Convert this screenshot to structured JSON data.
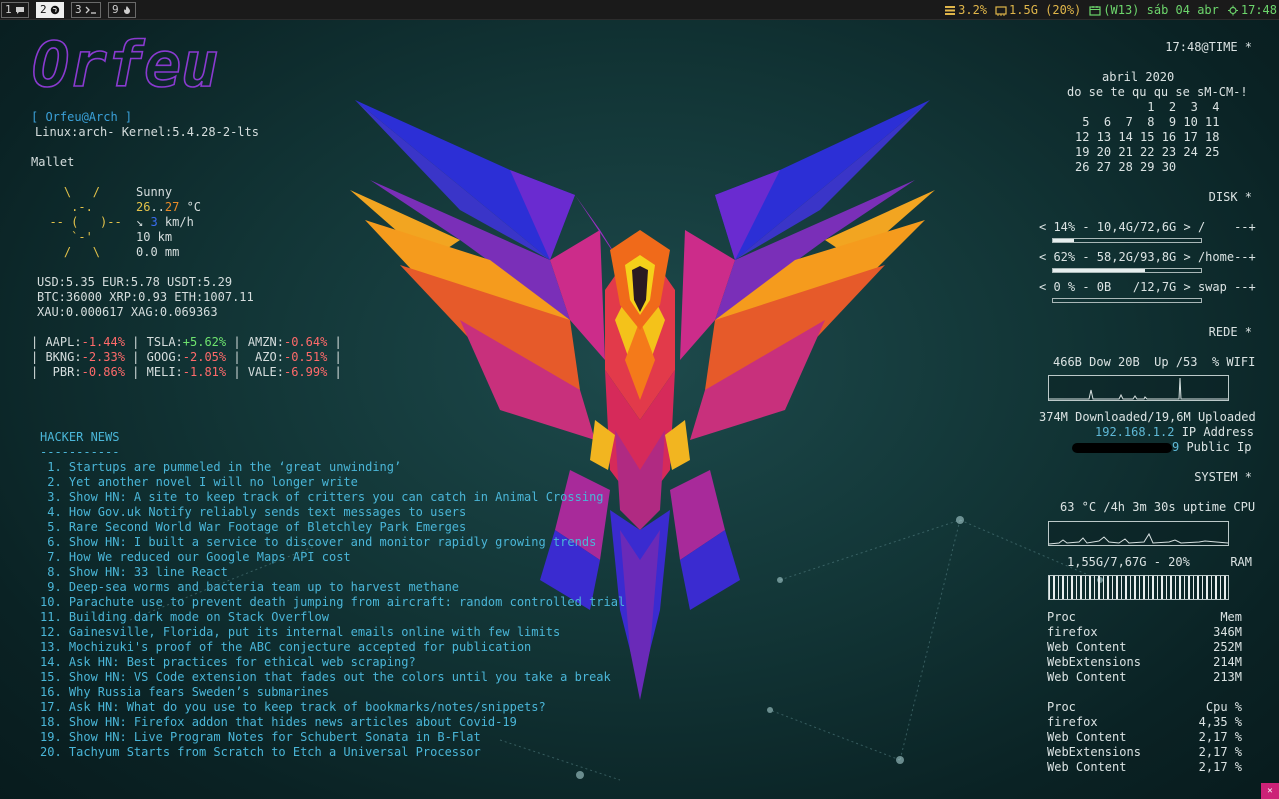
{
  "topbar": {
    "workspaces": [
      {
        "num": "1",
        "icon": "chat-icon",
        "active": false
      },
      {
        "num": "2",
        "icon": "globe-icon",
        "active": true
      },
      {
        "num": "3",
        "icon": "terminal-icon",
        "active": false
      },
      {
        "num": "9",
        "icon": "fire-icon",
        "active": false
      }
    ],
    "cpu": "3.2%",
    "memory": "1.5G (20%)",
    "date": "(W13) sáb 04 abr",
    "time": "17:48"
  },
  "left": {
    "user": "[ Orfeu@Arch ]",
    "kernel": "Linux:arch- Kernel:5.4.28-2-lts",
    "location": "Mallet",
    "weather": {
      "art": [
        "    \\   /    ",
        "     .-.     ",
        "  -- (   )-- ",
        "     `-'     ",
        "    /   \\    "
      ],
      "condition": "Sunny",
      "temp_lo": "26",
      "temp_sep": "..",
      "temp_hi": "27",
      "temp_unit": " °C",
      "wind_arrow": "↘",
      "wind_speed": "3",
      "wind_unit": " km/h",
      "visibility": "10 km",
      "rain": "0.0 mm"
    },
    "currency": [
      "USD:5.35 EUR:5.78 USDT:5.29",
      "BTC:36000 XRP:0.93 ETH:1007.11",
      "XAU:0.000617 XAG:0.069363"
    ],
    "stocks": [
      [
        {
          "sym": "AAPL",
          "val": "-1.44%",
          "pos": false
        },
        {
          "sym": "TSLA",
          "val": "+5.62%",
          "pos": true
        },
        {
          "sym": "AMZN",
          "val": "-0.64%",
          "pos": false
        }
      ],
      [
        {
          "sym": "BKNG",
          "val": "-2.33%",
          "pos": false
        },
        {
          "sym": "GOOG",
          "val": "-2.05%",
          "pos": false
        },
        {
          "sym": " AZO",
          "val": "-0.51%",
          "pos": false
        }
      ],
      [
        {
          "sym": " PBR",
          "val": "-0.86%",
          "pos": false
        },
        {
          "sym": "MELI",
          "val": "-1.81%",
          "pos": false
        },
        {
          "sym": "VALE",
          "val": "-6.99%",
          "pos": false
        }
      ]
    ],
    "hn_title": "HACKER NEWS",
    "hn_sep": "-----------",
    "hn_items": [
      " 1. Startups are pummeled in the ‘great unwinding’",
      " 2. Yet another novel I will no longer write",
      " 3. Show HN: A site to keep track of critters you can catch in Animal Crossing",
      " 4. How Gov.uk Notify reliably sends text messages to users",
      " 5. Rare Second World War Footage of Bletchley Park Emerges",
      " 6. Show HN: I built a service to discover and monitor rapidly growing trends",
      " 7. How We reduced our Google Maps API cost",
      " 8. Show HN: 33 line React",
      " 9. Deep-sea worms and bacteria team up to harvest methane",
      "10. Parachute use to prevent death jumping from aircraft: random controlled trial",
      "11. Building dark mode on Stack Overflow",
      "12. Gainesville, Florida, put its internal emails online with few limits",
      "13. Mochizuki's proof of the ABC conjecture accepted for publication",
      "14. Ask HN: Best practices for ethical web scraping?",
      "15. Show HN: VS Code extension that fades out the colors until you take a break",
      "16. Why Russia fears Sweden’s submarines",
      "17. Ask HN: What do you use to keep track of bookmarks/notes/snippets?",
      "18. Show HN: Firefox addon that hides news articles about Covid-19",
      "19. Show HN: Live Program Notes for Schubert Sonata in B-Flat",
      "20. Tachyum Starts from Scratch to Etch a Universal Processor"
    ]
  },
  "right": {
    "time_header": "17:48@TIME *",
    "calendar": {
      "month": "abril 2020",
      "days_header": "do se te qu qu se sM-CM-!",
      "weeks": [
        "          1  2  3  4",
        " 5  6  7  8  9 10 11",
        "12 13 14 15 16 17 18",
        "19 20 21 22 23 24 25",
        "26 27 28 29 30"
      ]
    },
    "disk_header": "DISK *",
    "disks": [
      {
        "line": "< 14% - 10,4G/72,6G > /    --+",
        "fraction": 0.14
      },
      {
        "line": "< 62% - 58,2G/93,8G > /home--+",
        "fraction": 0.62
      },
      {
        "line": "< 0 % - 0B   /12,7G > swap --+",
        "fraction": 0.0
      }
    ],
    "net_header": "REDE *",
    "net_line": "466B Dow 20B  Up /53  % WIFI",
    "net_total": "374M Downloaded/19,6M Uploaded",
    "local_ip": "192.168.1.2",
    "local_ip_label": " IP Address",
    "public_ip_tail": "9",
    "public_ip_label": " Public Ip",
    "system_header": "SYSTEM *",
    "cpu_line": "63 °C /4h 3m 30s uptime CPU",
    "ram_line": "1,55G/7,67G - 20%",
    "ram_label": "RAM",
    "mem_table": {
      "col1": "Proc",
      "col2": "Mem",
      "rows": [
        [
          "firefox",
          "346M"
        ],
        [
          "Web Content",
          "252M"
        ],
        [
          "WebExtensions",
          "214M"
        ],
        [
          "Web Content",
          "213M"
        ]
      ]
    },
    "cpu_table": {
      "col1": "Proc",
      "col2": "Cpu %",
      "rows": [
        [
          "firefox",
          "4,35 %"
        ],
        [
          "Web Content",
          "2,17 %"
        ],
        [
          "WebExtensions",
          "2,17 %"
        ],
        [
          "Web Content",
          "2,17 %"
        ]
      ]
    }
  },
  "logo_text": "Orfeu",
  "colors": {
    "bar_bg": "#1a1a1a",
    "bar_text": "#e0b64a",
    "link_blue": "#3aa0d8",
    "hn_text": "#4ab6d8",
    "negative": "#ff6a6a",
    "positive": "#6ee36e"
  }
}
